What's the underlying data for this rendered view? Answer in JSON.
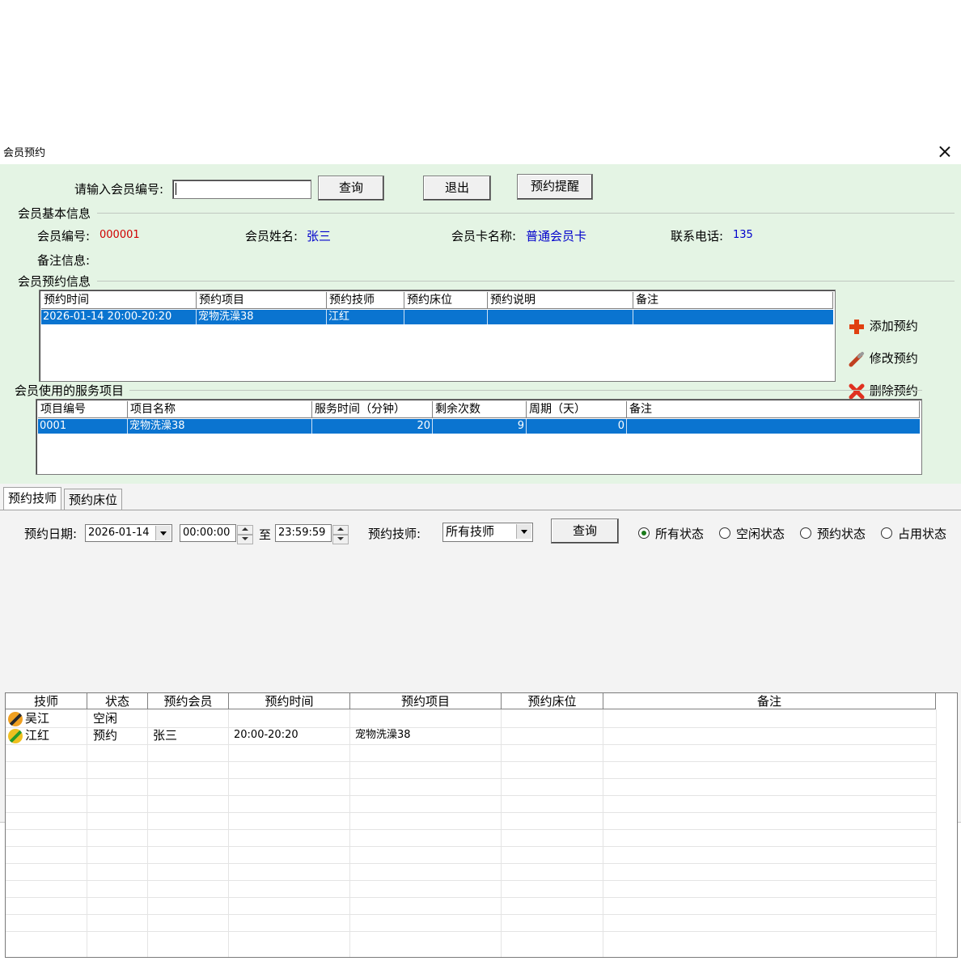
{
  "window": {
    "title": "会员预约"
  },
  "search": {
    "label": "请输入会员编号:",
    "value": "",
    "query_btn": "查询",
    "exit_btn": "退出",
    "remind_btn": "预约提醒"
  },
  "basic": {
    "group_title": "会员基本信息",
    "id_label": "会员编号:",
    "id_value": "000001",
    "name_label": "会员姓名:",
    "name_value": "张三",
    "card_label": "会员卡名称:",
    "card_value": "普通会员卡",
    "phone_label": "联系电话:",
    "phone_value": "135",
    "note_label": "备注信息:"
  },
  "reservation": {
    "group_title": "会员预约信息",
    "columns": [
      "预约时间",
      "预约项目",
      "预约技师",
      "预约床位",
      "预约说明",
      "备注"
    ],
    "rows": [
      [
        "2026-01-14 20:00-20:20",
        "宠物洗澡38",
        "江红",
        "",
        "",
        ""
      ]
    ],
    "add_btn": "添加预约",
    "edit_btn": "修改预约",
    "delete_btn": "删除预约"
  },
  "services": {
    "group_title": "会员使用的服务项目",
    "columns": [
      "项目编号",
      "项目名称",
      "服务时间（分钟）",
      "剩余次数",
      "周期（天）",
      "备注"
    ],
    "rows": [
      [
        "0001",
        "宠物洗澡38",
        "20",
        "9",
        "0",
        ""
      ]
    ]
  },
  "tabs": [
    "预约技师",
    "预约床位"
  ],
  "filter": {
    "date_label": "预约日期:",
    "date_value": "2026-01-14",
    "time_from": "00:00:00",
    "to_label": "至",
    "time_to": "23:59:59",
    "tech_label": "预约技师:",
    "tech_value": "所有技师",
    "query_btn": "查询",
    "radios": [
      "所有状态",
      "空闲状态",
      "预约状态",
      "占用状态"
    ],
    "selected_radio": 0
  },
  "tech_grid": {
    "columns": [
      "技师",
      "状态",
      "预约会员",
      "预约时间",
      "预约项目",
      "预约床位",
      "备注"
    ],
    "rows": [
      {
        "tech": "吴江",
        "status": "空闲",
        "member": "",
        "time": "",
        "project": "",
        "bed": "",
        "note": ""
      },
      {
        "tech": "江红",
        "status": "预约",
        "member": "张三",
        "time": "20:00-20:20",
        "project": "宠物洗澡38",
        "bed": "",
        "note": ""
      }
    ]
  },
  "colors": {
    "panel_green": "#e4f4e4",
    "selection_blue": "#0a74d0",
    "value_red": "#d00000",
    "value_blue": "#0000cc"
  }
}
